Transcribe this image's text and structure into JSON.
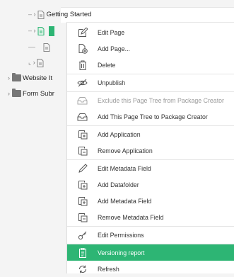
{
  "tree": {
    "getting_started": "Getting Started",
    "website_label": "Website It",
    "form_label": "Form Subr"
  },
  "menu": {
    "edit_page": "Edit Page",
    "add_page": "Add Page...",
    "delete": "Delete",
    "unpublish": "Unpublish",
    "exclude_tree": "Exclude this Page Tree from Package Creator",
    "add_tree": "Add This Page Tree to Package Creator",
    "add_application": "Add Application",
    "remove_application": "Remove Application",
    "edit_metadata_field": "Edit Metadata Field",
    "add_datafolder": "Add Datafolder",
    "add_metadata_field": "Add Metadata Field",
    "remove_metadata_field": "Remove Metadata Field",
    "edit_permissions": "Edit Permissions",
    "versioning_report": "Versioning report",
    "refresh": "Refresh"
  },
  "colors": {
    "accent": "#2db574",
    "background": "#f4f4f4"
  },
  "icons": {
    "page": "page-icon",
    "folder": "folder-icon",
    "edit": "pencil-page-icon",
    "add_page": "add-page-icon",
    "delete": "trash-icon",
    "unpublish": "eye-slash-icon",
    "package": "package-tray-icon",
    "application": "application-icon",
    "pen": "pen-icon",
    "permissions": "key-icon",
    "report": "report-icon",
    "refresh": "refresh-icon"
  }
}
